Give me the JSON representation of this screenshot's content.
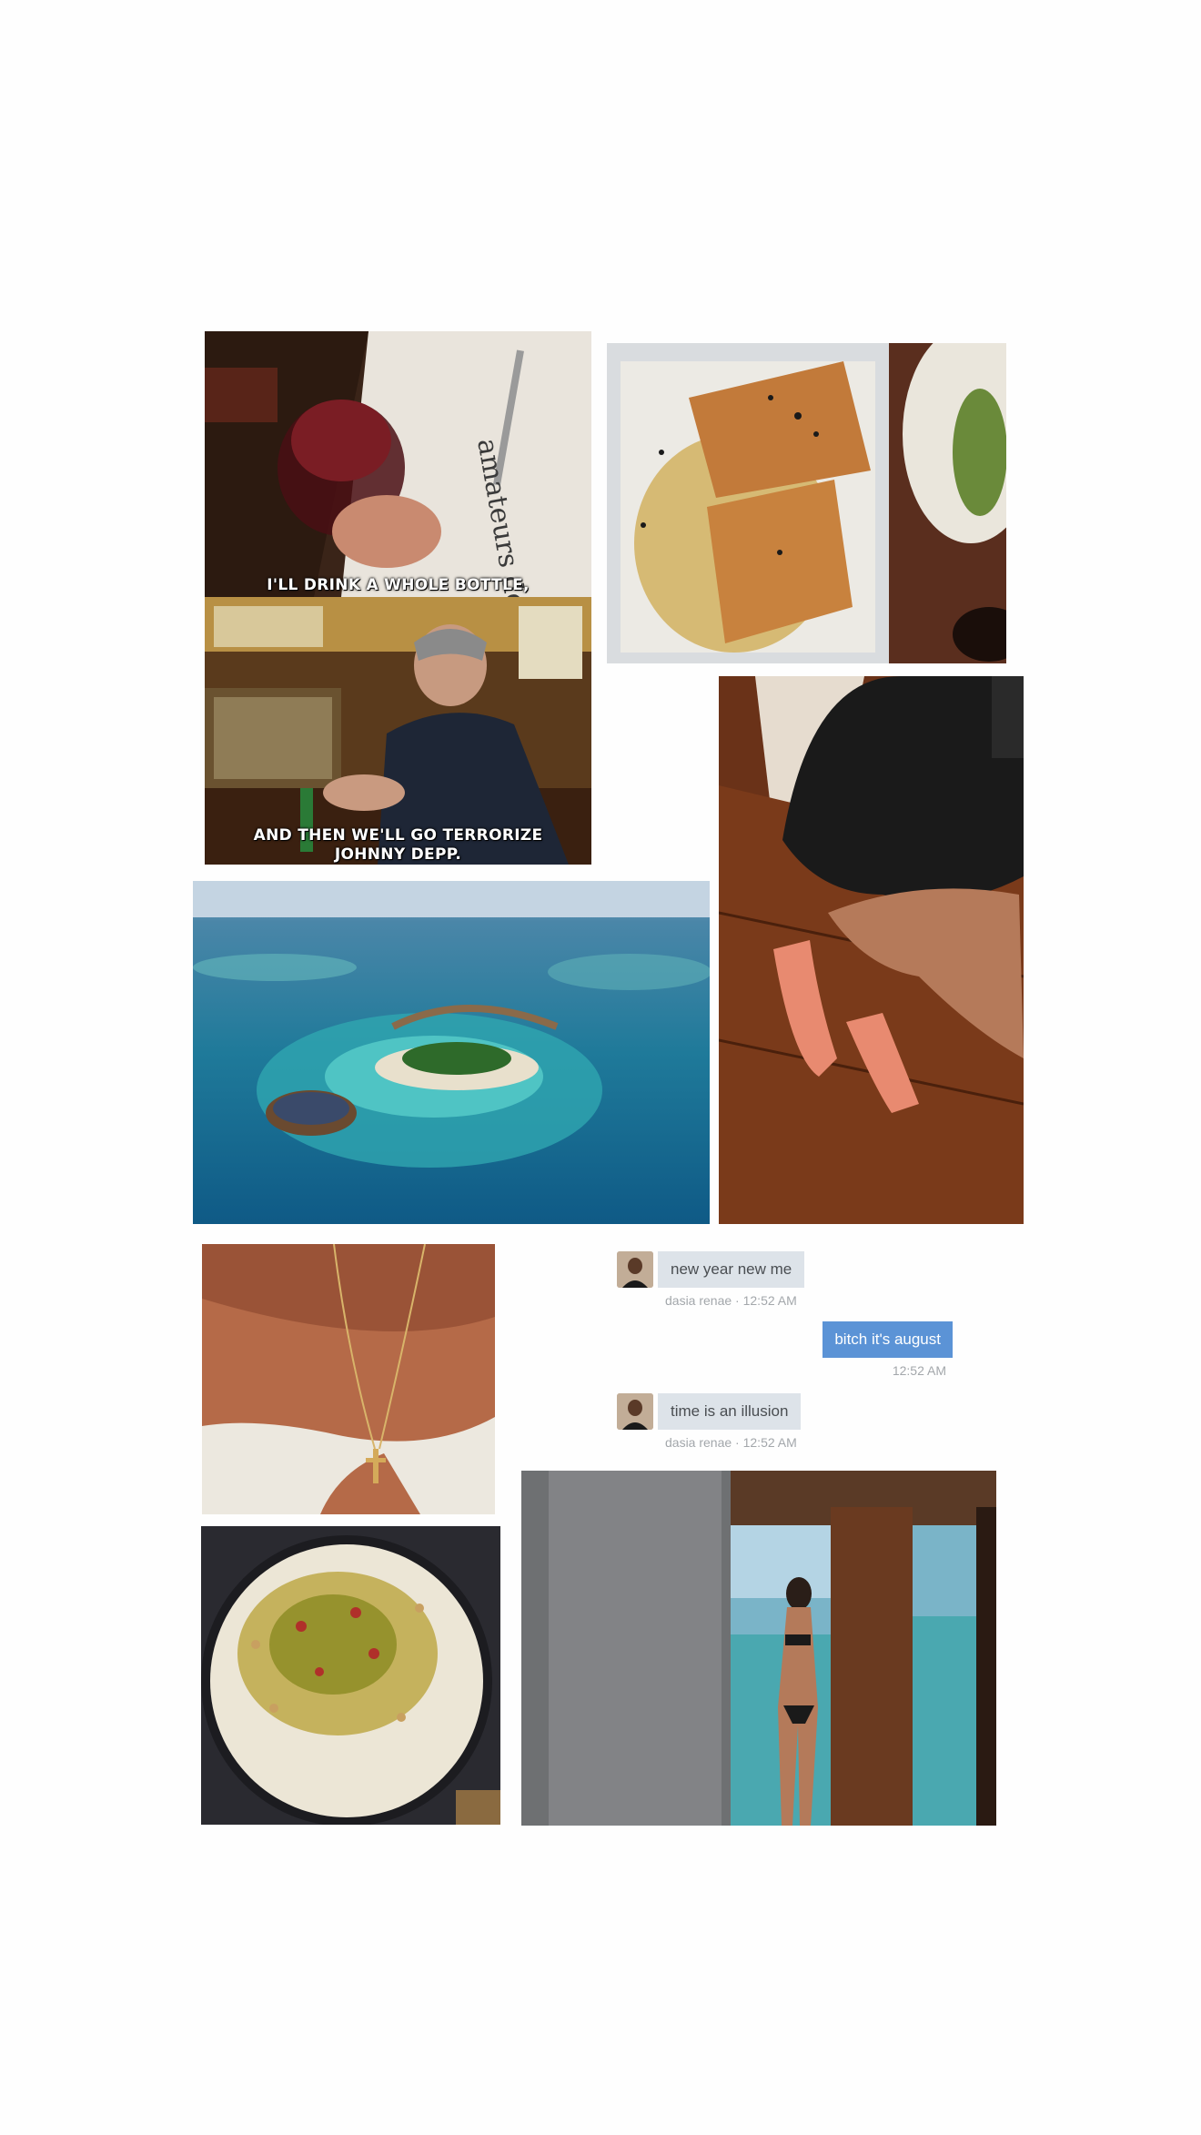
{
  "captions": {
    "dinner_top": "I'LL DRINK A WHOLE BOTTLE,",
    "dinner_bottom_line1": "AND THEN WE'LL GO TERRORIZE",
    "dinner_bottom_line2": "JOHNNY DEPP."
  },
  "chat": {
    "messages": [
      {
        "side": "incoming",
        "text": "new year new me",
        "sender": "dasia renae",
        "time": "12:52 AM",
        "meta": "dasia renae · 12:52 AM"
      },
      {
        "side": "outgoing",
        "text": "bitch it's august",
        "time": "12:52 AM",
        "meta": "12:52 AM"
      },
      {
        "side": "incoming",
        "text": "time is an illusion",
        "sender": "dasia renae",
        "time": "12:52 AM",
        "meta": "dasia renae · 12:52 AM"
      }
    ]
  },
  "colors": {
    "page_background": "#fefefe",
    "incoming_bubble": "#dde3e9",
    "outgoing_bubble": "#5b93d6",
    "meta_text": "#a3a7ab"
  }
}
